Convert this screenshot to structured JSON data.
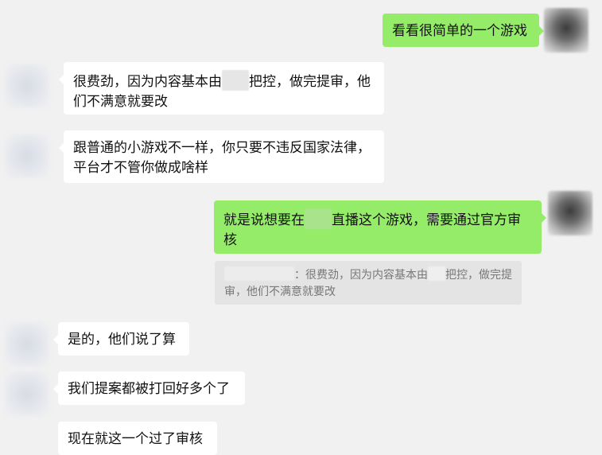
{
  "messages": {
    "m1": {
      "sender": "me",
      "text": "看看很简单的一个游戏"
    },
    "m2": {
      "sender": "other",
      "text_a": "很费劲，因为内容基本由",
      "text_b": "把控，做完提审，他们不满意就要改"
    },
    "m3": {
      "sender": "other",
      "text": "跟普通的小游戏不一样，你只要不违反国家法律，平台才不管你做成啥样"
    },
    "m4": {
      "sender": "me",
      "text_a": "就是说想要在",
      "text_b": "直播这个游戏，需要通过官方审核"
    },
    "m5": {
      "sender": "other",
      "text": "是的，他们说了算"
    },
    "m6": {
      "sender": "other",
      "text": "我们提案都被打回好多个了"
    },
    "m7": {
      "sender": "other",
      "text": "现在就这一个过了审核"
    }
  },
  "quote": {
    "text_a": "：很费劲，因为内容基本由",
    "text_b": "把控，做完提审，他们不满意就要改"
  },
  "colors": {
    "background": "#f1f1f1",
    "self_bubble": "#95ec69",
    "other_bubble": "#ffffff",
    "quote_bg": "#e4e4e4"
  }
}
